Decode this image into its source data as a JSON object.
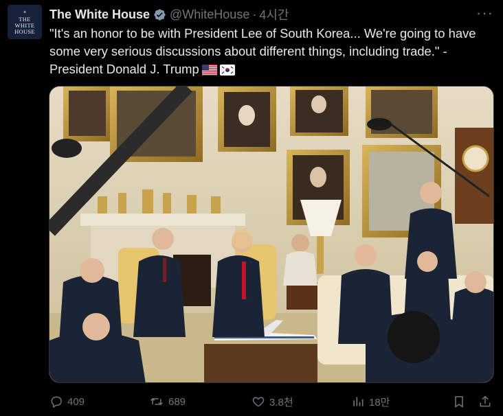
{
  "account": {
    "avatar_line1": "THE",
    "avatar_line2": "WHITE",
    "avatar_line3": "HOUSE",
    "name": "The White House",
    "handle": "@WhiteHouse",
    "separator": "·",
    "time": "4시간",
    "more": "···"
  },
  "tweet": {
    "text": "\"It's an honor to be with President Lee of South Korea... We're going to have some very serious discussions about different things, including trade.\" - President Donald J. Trump",
    "flags": [
      "us-flag",
      "south-korea-flag"
    ]
  },
  "actions": {
    "replies": "409",
    "retweets": "689",
    "likes": "3.8천",
    "views": "18만"
  },
  "colors": {
    "background": "#000000",
    "text": "#e7e9ea",
    "muted": "#71767b",
    "verified": "#829aab"
  }
}
